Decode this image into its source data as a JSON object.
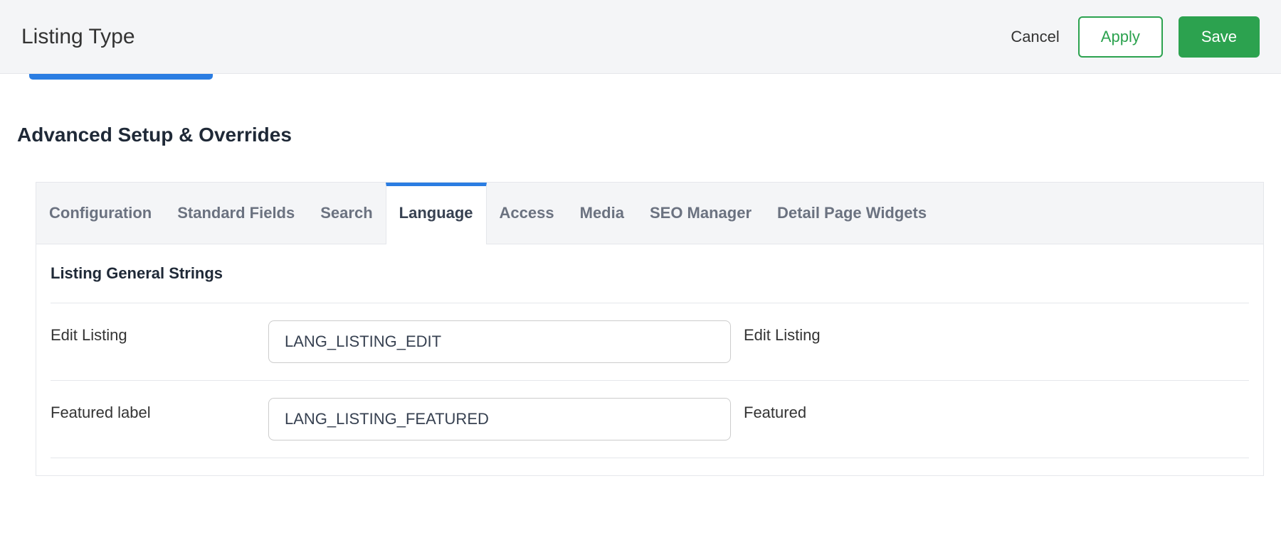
{
  "header": {
    "title": "Listing Type",
    "cancel_label": "Cancel",
    "apply_label": "Apply",
    "save_label": "Save"
  },
  "section": {
    "title": "Advanced Setup & Overrides"
  },
  "tabs": {
    "configuration": "Configuration",
    "standard_fields": "Standard Fields",
    "search": "Search",
    "language": "Language",
    "access": "Access",
    "media": "Media",
    "seo_manager": "SEO Manager",
    "detail_page_widgets": "Detail Page Widgets",
    "active": "language"
  },
  "group": {
    "title": "Listing General Strings"
  },
  "rows": [
    {
      "label": "Edit Listing",
      "input": "LANG_LISTING_EDIT",
      "value": "Edit Listing"
    },
    {
      "label": "Featured label",
      "input": "LANG_LISTING_FEATURED",
      "value": "Featured"
    }
  ]
}
